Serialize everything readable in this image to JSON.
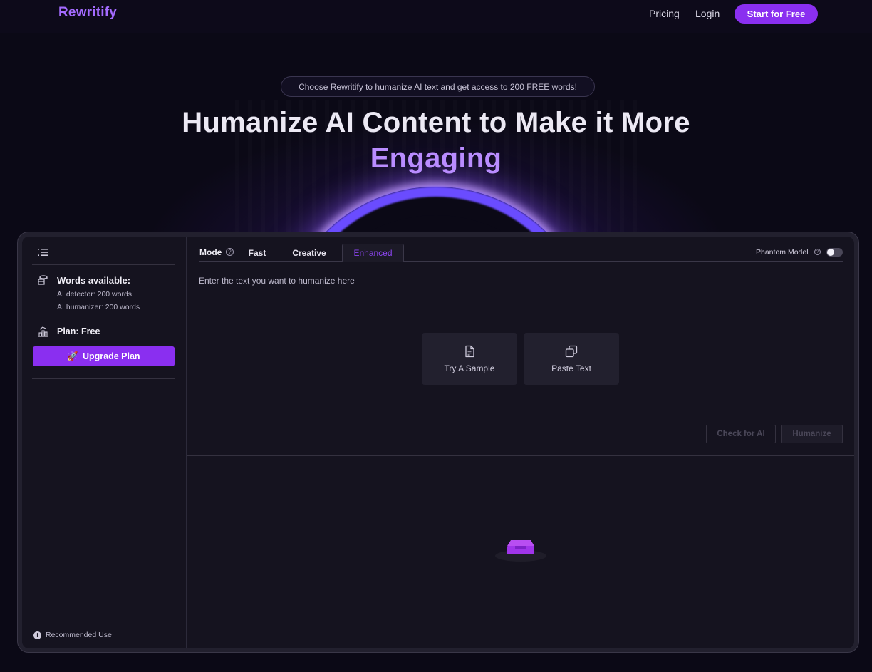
{
  "header": {
    "logo": "Rewritify",
    "nav": {
      "pricing": "Pricing",
      "login": "Login"
    },
    "cta": "Start for Free"
  },
  "hero": {
    "badge": "Choose Rewritify to humanize AI text and get access to 200 FREE words!",
    "title": "Humanize AI Content to Make it More",
    "title_accent": "Engaging"
  },
  "sidebar": {
    "words_title": "Words available:",
    "ai_detector": "AI detector: 200 words",
    "ai_humanizer": "AI humanizer: 200 words",
    "plan": "Plan: Free",
    "upgrade_emoji": "🚀",
    "upgrade_label": "Upgrade Plan",
    "recommended": "Recommended Use"
  },
  "editor": {
    "mode_label": "Mode",
    "tabs": {
      "fast": "Fast",
      "creative": "Creative",
      "enhanced": "Enhanced"
    },
    "active_tab": "Enhanced",
    "phantom_label": "Phantom Model",
    "phantom_enabled": false,
    "placeholder": "Enter the text you want to humanize here",
    "try_sample": "Try A Sample",
    "paste_text": "Paste Text",
    "check_button": "Check for AI",
    "humanize_button": "Humanize"
  },
  "colors": {
    "accent": "#8a2ff0",
    "logo": "#a46bff",
    "title_accent": "#b98cff",
    "background": "#0b0916",
    "panel": "#15131f"
  },
  "icons": {
    "menu": "menu-collapse-icon",
    "words": "coins-icon",
    "plan": "plan-chart-icon",
    "help": "help-circle-icon",
    "sample": "document-icon",
    "paste": "copy-icon",
    "info": "info-icon",
    "empty": "empty-inbox-icon"
  }
}
